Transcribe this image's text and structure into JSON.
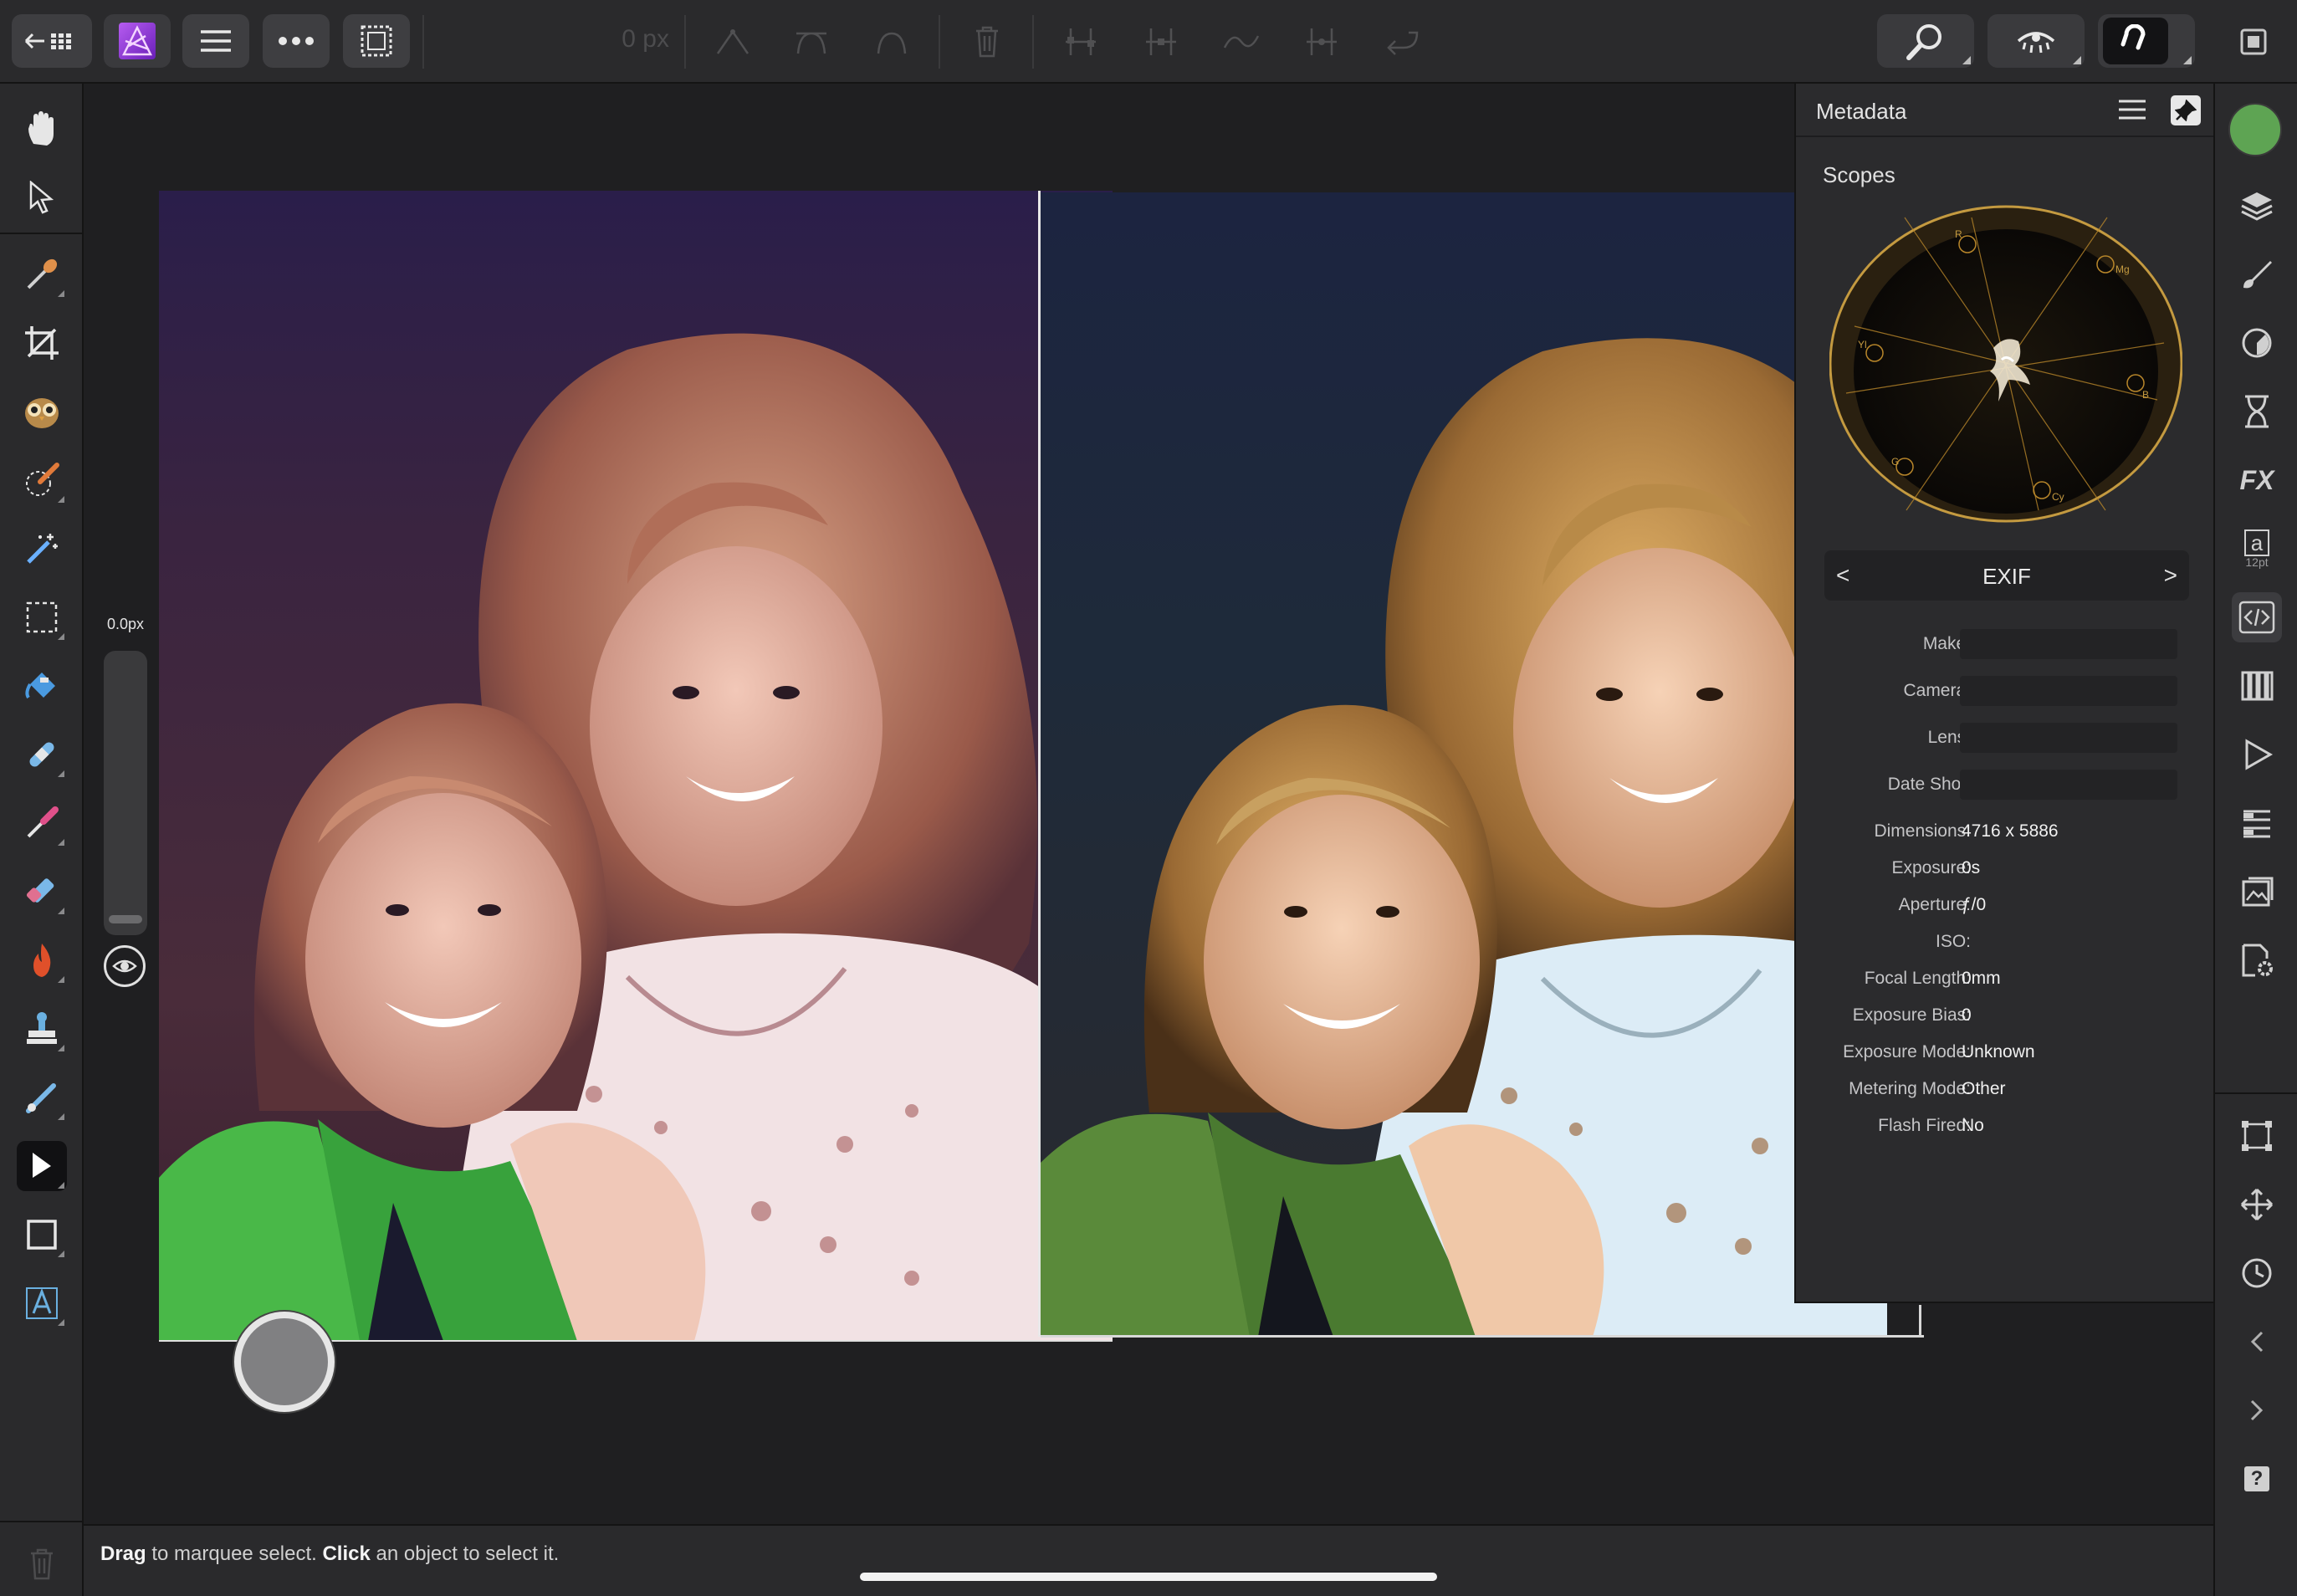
{
  "toolbar": {
    "width_field": "0 px"
  },
  "slider": {
    "value": "0.0px"
  },
  "status": {
    "drag_word": "Drag",
    "drag_text": " to marquee select. ",
    "click_word": "Click",
    "click_text": " an object to select it."
  },
  "panel": {
    "title": "Metadata",
    "scopes_title": "Scopes",
    "scope_labels": [
      "R",
      "Mg",
      "B",
      "Cy",
      "G",
      "Yl"
    ],
    "exif_label": "EXIF",
    "prev_arrow": "<",
    "next_arrow": ">",
    "fields": [
      {
        "label": "Make:",
        "value": "",
        "input": true
      },
      {
        "label": "Camera:",
        "value": "",
        "input": true
      },
      {
        "label": "Lens:",
        "value": "",
        "input": true
      },
      {
        "label": "Date Shot:",
        "value": "",
        "input": true
      },
      {
        "label": "Dimensions:",
        "value": "4716 x 5886",
        "input": false
      },
      {
        "label": "Exposure:",
        "value": "0s",
        "input": false
      },
      {
        "label": "Aperture:",
        "value": "ƒ/0",
        "input": false
      },
      {
        "label": "ISO:",
        "value": "",
        "input": false
      },
      {
        "label": "Focal Length:",
        "value": "0mm",
        "input": false
      },
      {
        "label": "Exposure Bias:",
        "value": "0",
        "input": false
      },
      {
        "label": "Exposure Mode:",
        "value": "Unknown",
        "input": false
      },
      {
        "label": "Metering Mode:",
        "value": "Other",
        "input": false
      },
      {
        "label": "Flash Fired:",
        "value": "No",
        "input": false
      }
    ]
  },
  "right_bar": {
    "text_style_sub": "12pt",
    "text_style_glyph": "a",
    "fx_glyph": "FX",
    "help_glyph": "?"
  },
  "colors": {
    "accent_app_icon": "#8a3fd6",
    "color_swatch": "#5ea453",
    "scope_ring": "#b8862a"
  }
}
